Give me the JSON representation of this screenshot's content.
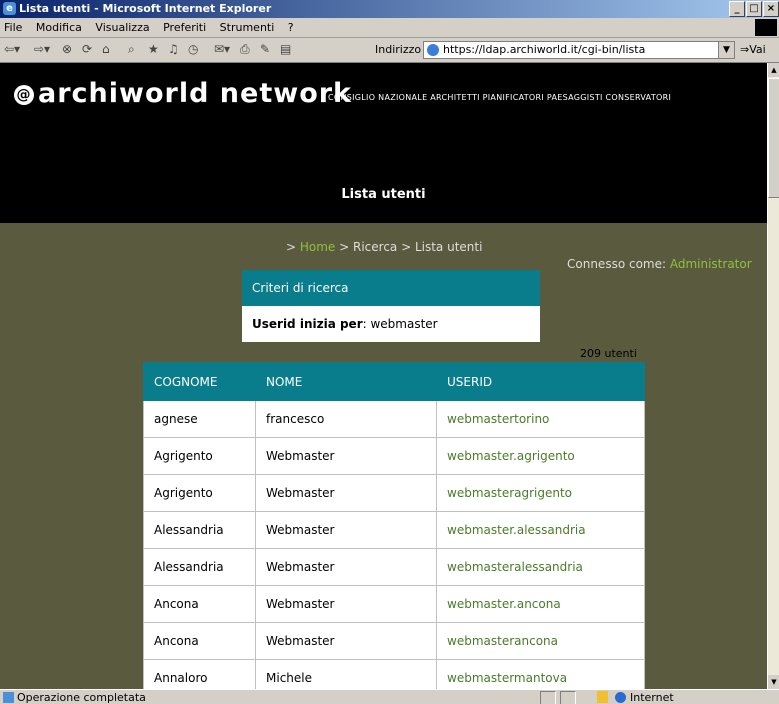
{
  "window": {
    "title": "Lista utenti - Microsoft Internet Explorer"
  },
  "menu": [
    "File",
    "Modifica",
    "Visualizza",
    "Preferiti",
    "Strumenti",
    "?"
  ],
  "toolbar": {
    "address_label": "Indirizzo",
    "url": "https://ldap.archiworld.it/cgi-bin/lista",
    "go_label": "Vai"
  },
  "header": {
    "brand": "archiworld network",
    "tagline": "CONSIGLIO NAZIONALE ARCHITETTI PIANIFICATORI PAESAGGISTI CONSERVATORI",
    "page_title": "Lista utenti"
  },
  "breadcrumb": {
    "prefix": "> ",
    "home": "Home",
    "rest": " > Ricerca > Lista utenti"
  },
  "session": {
    "label": "Connesso come: ",
    "user": "Administrator"
  },
  "criteria": {
    "title": "Criteri di ricerca",
    "field_label": "Userid inizia per",
    "field_value": ": webmaster"
  },
  "results": {
    "count": "209 utenti",
    "columns": [
      "COGNOME",
      "NOME",
      "USERID"
    ],
    "rows": [
      [
        "agnese",
        "francesco",
        "webmastertorino"
      ],
      [
        "Agrigento",
        "Webmaster",
        "webmaster.agrigento"
      ],
      [
        "Agrigento",
        "Webmaster",
        "webmasteragrigento"
      ],
      [
        "Alessandria",
        "Webmaster",
        "webmaster.alessandria"
      ],
      [
        "Alessandria",
        "Webmaster",
        "webmasteralessandria"
      ],
      [
        "Ancona",
        "Webmaster",
        "webmaster.ancona"
      ],
      [
        "Ancona",
        "Webmaster",
        "webmasterancona"
      ],
      [
        "Annaloro",
        "Michele",
        "webmastermantova"
      ]
    ]
  },
  "status": {
    "text": "Operazione completata",
    "zone": "Internet"
  },
  "colors": {
    "teal": "#0a7d8c",
    "olive_bg": "#5a5a3f",
    "link_green": "#8fc13f"
  }
}
